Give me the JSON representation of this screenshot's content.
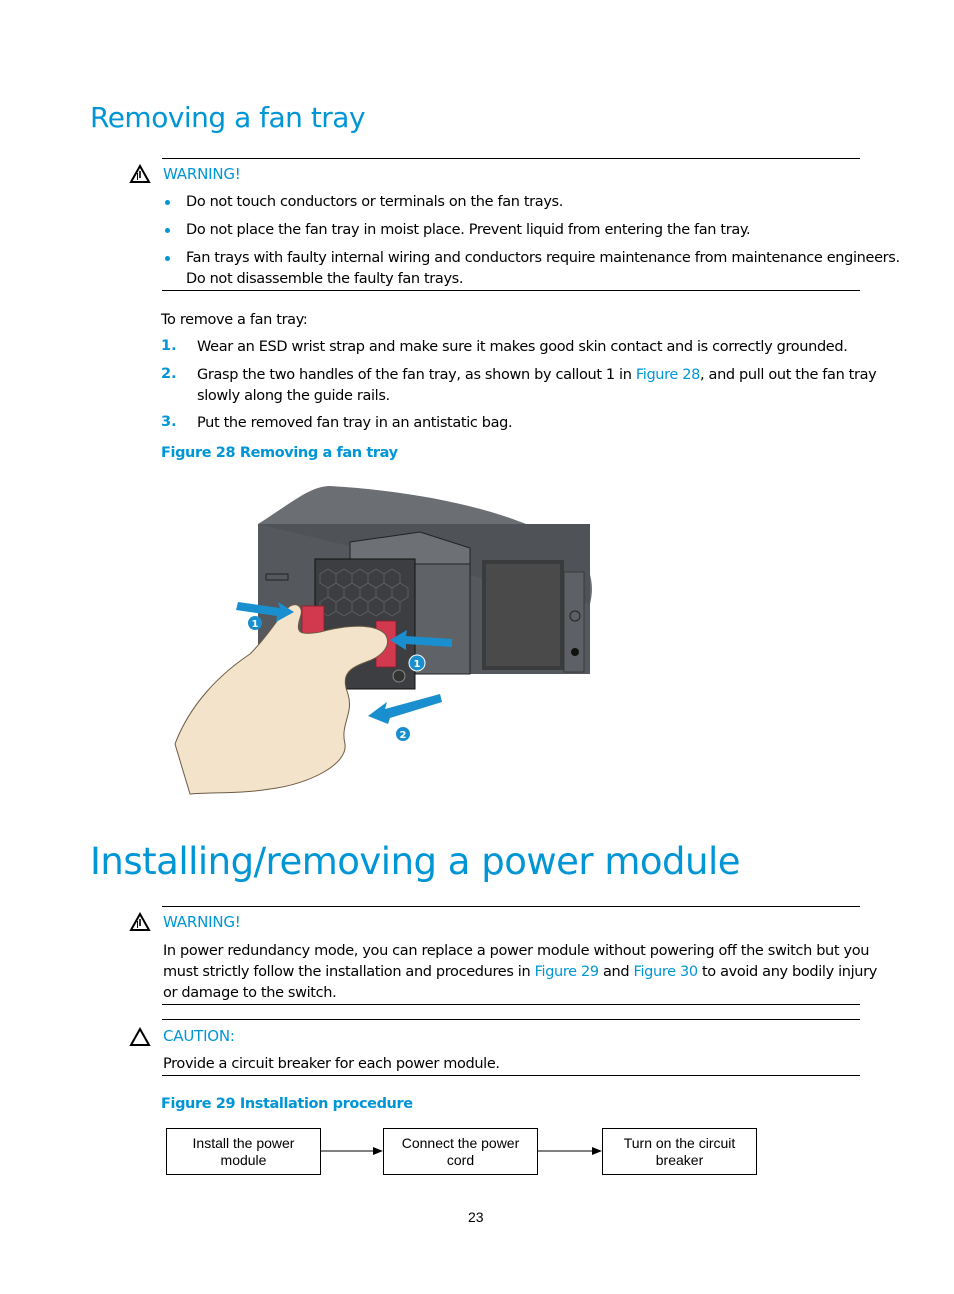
{
  "section1": {
    "title": "Removing a fan tray",
    "warning": {
      "label": "WARNING!",
      "icon": "warning-triangle-icon",
      "bullets": [
        "Do not touch conductors or terminals on the fan trays.",
        "Do not place the fan tray in moist place. Prevent liquid from entering the fan tray.",
        "Fan trays with faulty internal wiring and conductors require maintenance from maintenance engineers.",
        "Do not disassemble the faulty fan trays."
      ]
    },
    "intro": "To remove a fan tray:",
    "steps": [
      {
        "num": "1.",
        "text": "Wear an ESD wrist strap and make sure it makes good skin contact and is correctly grounded."
      },
      {
        "num": "2.",
        "text_before": "Grasp the two handles of the fan tray, as shown by callout 1 in ",
        "link": "Figure 28",
        "text_after": ", and pull out the fan tray",
        "text_line2": "slowly along the guide rails."
      },
      {
        "num": "3.",
        "text": "Put the removed fan tray in an antistatic bag."
      }
    ],
    "figure_caption": "Figure 28 Removing a fan tray",
    "figure": {
      "callouts": [
        "1",
        "1",
        "2"
      ],
      "colors": {
        "callout": "#1a8fd0",
        "handle": "#d2394f",
        "chassis": "#5c5f63",
        "hand": "#f4e3cb"
      }
    }
  },
  "section2": {
    "title": "Installing/removing a power module",
    "warning": {
      "label": "WARNING!",
      "icon": "warning-triangle-icon",
      "line1": "In power redundancy mode, you can replace a power module without powering off the switch but you",
      "line2_before": "must strictly follow the installation and procedures in ",
      "link1": "Figure 29",
      "line2_mid": " and ",
      "link2": "Figure 30",
      "line2_after": " to avoid any bodily injury",
      "line3": "or damage to the switch."
    },
    "caution": {
      "label": "CAUTION:",
      "icon": "caution-triangle-icon",
      "text": "Provide a circuit breaker for each power module."
    },
    "figure_caption": "Figure 29 Installation procedure",
    "flow": [
      {
        "line1": "Install the power",
        "line2": "module"
      },
      {
        "line1": "Connect the power",
        "line2": "cord"
      },
      {
        "line1": "Turn on the circuit",
        "line2": "breaker"
      }
    ]
  },
  "page_number": "23",
  "colors": {
    "accent": "#0096d6",
    "text": "#000000"
  }
}
